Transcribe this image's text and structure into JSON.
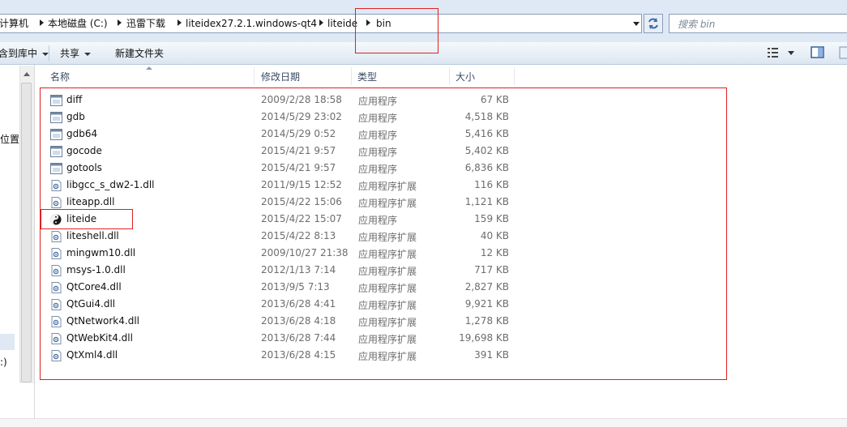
{
  "breadcrumb": {
    "items": [
      "计算机",
      "本地磁盘 (C:)",
      "迅雷下载",
      "liteidex27.2.1.windows-qt4",
      "liteide",
      "bin"
    ]
  },
  "search": {
    "placeholder": "搜索 bin"
  },
  "toolbar": {
    "organize_label": "包含到库中",
    "share_label": "共享",
    "new_folder_label": "新建文件夹"
  },
  "nav": {
    "items": [
      "位置",
      ":)",
      ":)"
    ]
  },
  "columns": {
    "name": "名称",
    "modified": "修改日期",
    "type": "类型",
    "size": "大小"
  },
  "files": [
    {
      "name": "diff",
      "date": "2009/2/28 18:58",
      "type": "应用程序",
      "size": "67 KB",
      "icon": "app-window-icon"
    },
    {
      "name": "gdb",
      "date": "2014/5/29 23:02",
      "type": "应用程序",
      "size": "4,518 KB",
      "icon": "app-window-icon"
    },
    {
      "name": "gdb64",
      "date": "2014/5/29 0:52",
      "type": "应用程序",
      "size": "5,416 KB",
      "icon": "app-window-icon"
    },
    {
      "name": "gocode",
      "date": "2015/4/21 9:57",
      "type": "应用程序",
      "size": "5,402 KB",
      "icon": "app-window-icon"
    },
    {
      "name": "gotools",
      "date": "2015/4/21 9:57",
      "type": "应用程序",
      "size": "6,836 KB",
      "icon": "app-window-icon"
    },
    {
      "name": "libgcc_s_dw2-1.dll",
      "date": "2011/9/15 12:52",
      "type": "应用程序扩展",
      "size": "116 KB",
      "icon": "dll-gear-icon"
    },
    {
      "name": "liteapp.dll",
      "date": "2015/4/22 15:06",
      "type": "应用程序扩展",
      "size": "1,121 KB",
      "icon": "dll-gear-icon"
    },
    {
      "name": "liteide",
      "date": "2015/4/22 15:07",
      "type": "应用程序",
      "size": "159 KB",
      "icon": "liteide-logo-icon"
    },
    {
      "name": "liteshell.dll",
      "date": "2015/4/22 8:13",
      "type": "应用程序扩展",
      "size": "40 KB",
      "icon": "dll-gear-icon"
    },
    {
      "name": "mingwm10.dll",
      "date": "2009/10/27 21:38",
      "type": "应用程序扩展",
      "size": "12 KB",
      "icon": "dll-gear-icon"
    },
    {
      "name": "msys-1.0.dll",
      "date": "2012/1/13 7:14",
      "type": "应用程序扩展",
      "size": "717 KB",
      "icon": "dll-gear-icon"
    },
    {
      "name": "QtCore4.dll",
      "date": "2013/9/5 7:13",
      "type": "应用程序扩展",
      "size": "2,827 KB",
      "icon": "dll-gear-icon"
    },
    {
      "name": "QtGui4.dll",
      "date": "2013/6/28 4:41",
      "type": "应用程序扩展",
      "size": "9,921 KB",
      "icon": "dll-gear-icon"
    },
    {
      "name": "QtNetwork4.dll",
      "date": "2013/6/28 4:18",
      "type": "应用程序扩展",
      "size": "1,278 KB",
      "icon": "dll-gear-icon"
    },
    {
      "name": "QtWebKit4.dll",
      "date": "2013/6/28 7:44",
      "type": "应用程序扩展",
      "size": "19,698 KB",
      "icon": "dll-gear-icon"
    },
    {
      "name": "QtXml4.dll",
      "date": "2013/6/28 4:15",
      "type": "应用程序扩展",
      "size": "391 KB",
      "icon": "dll-gear-icon"
    }
  ],
  "colors": {
    "annotation_red": "#e02020",
    "address_bg": "#dfe9f5",
    "secondary_text": "#6d6d6d"
  }
}
